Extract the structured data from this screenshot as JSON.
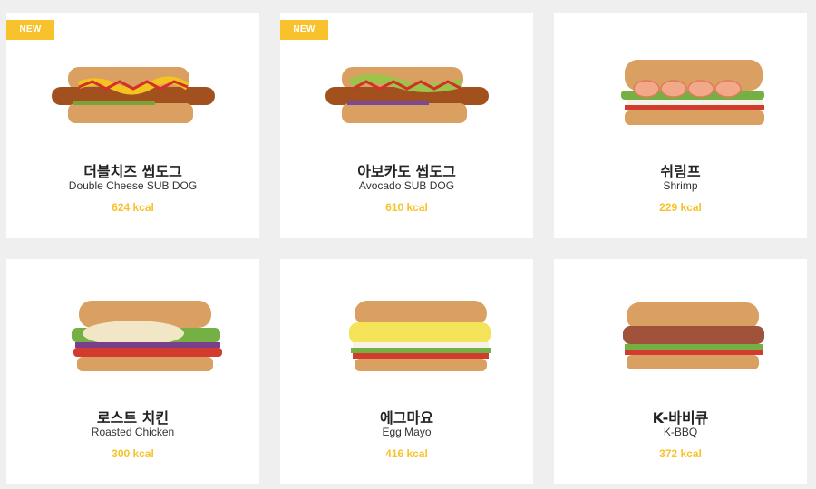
{
  "colors": {
    "accent": "#f8c22d",
    "background": "#efefef",
    "card": "#ffffff"
  },
  "menu": [
    {
      "badge": "NEW",
      "name_ko": "더블치즈 썹도그",
      "name_en": "Double Cheese SUB DOG",
      "kcal": "624 kcal",
      "image": "double-cheese-subdog"
    },
    {
      "badge": "NEW",
      "name_ko": "아보카도 썹도그",
      "name_en": "Avocado SUB DOG",
      "kcal": "610 kcal",
      "image": "avocado-subdog"
    },
    {
      "badge": "",
      "name_ko": "쉬림프",
      "name_en": "Shrimp",
      "kcal": "229 kcal",
      "image": "shrimp-sandwich"
    },
    {
      "badge": "",
      "name_ko": "로스트 치킨",
      "name_en": "Roasted Chicken",
      "kcal": "300 kcal",
      "image": "roasted-chicken-sandwich"
    },
    {
      "badge": "",
      "name_ko": "에그마요",
      "name_en": "Egg Mayo",
      "kcal": "416 kcal",
      "image": "egg-mayo-sandwich"
    },
    {
      "badge": "",
      "name_ko": "K-바비큐",
      "name_en": "K-BBQ",
      "kcal": "372 kcal",
      "image": "k-bbq-sandwich"
    }
  ]
}
